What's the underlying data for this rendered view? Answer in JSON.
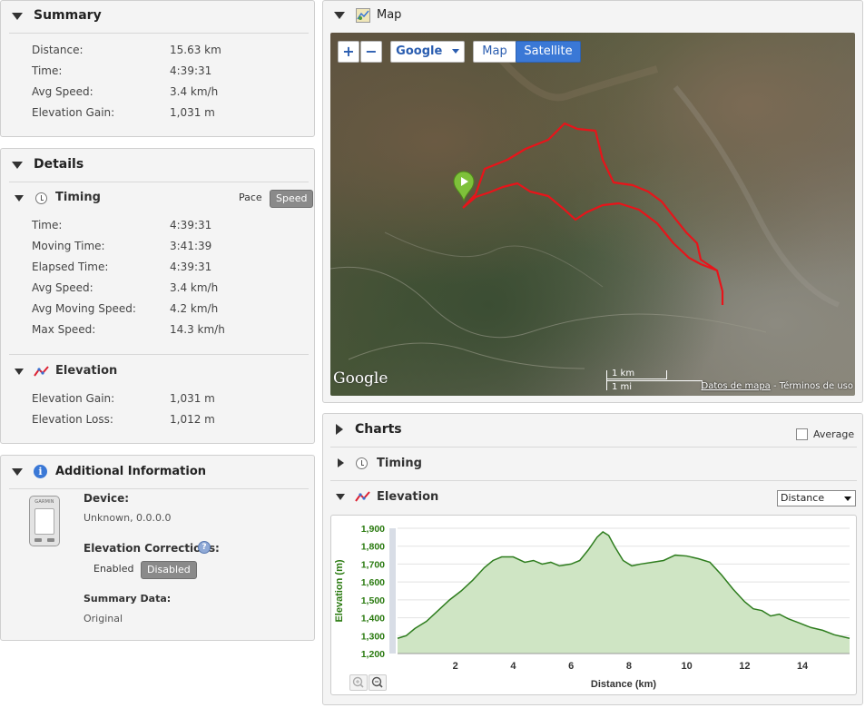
{
  "summary": {
    "title": "Summary",
    "rows": [
      {
        "label": "Distance:",
        "value": "15.63 km"
      },
      {
        "label": "Time:",
        "value": "4:39:31"
      },
      {
        "label": "Avg Speed:",
        "value": "3.4 km/h"
      },
      {
        "label": "Elevation Gain:",
        "value": "1,031 m"
      }
    ]
  },
  "details": {
    "title": "Details",
    "timing": {
      "title": "Timing",
      "pace_label": "Pace",
      "speed_label": "Speed",
      "rows": [
        {
          "label": "Time:",
          "value": "4:39:31"
        },
        {
          "label": "Moving Time:",
          "value": "3:41:39"
        },
        {
          "label": "Elapsed Time:",
          "value": "4:39:31"
        },
        {
          "label": "Avg Speed:",
          "value": "3.4 km/h"
        },
        {
          "label": "Avg Moving Speed:",
          "value": "4.2 km/h"
        },
        {
          "label": "Max Speed:",
          "value": "14.3 km/h"
        }
      ]
    },
    "elevation": {
      "title": "Elevation",
      "rows": [
        {
          "label": "Elevation Gain:",
          "value": "1,031 m"
        },
        {
          "label": "Elevation Loss:",
          "value": "1,012 m"
        }
      ]
    }
  },
  "additional": {
    "title": "Additional Information",
    "device_label": "Device:",
    "device_value": "Unknown, 0.0.0.0",
    "corrections_label": "Elevation Corrections",
    "corrections_colon": ":",
    "enabled_label": "Enabled",
    "disabled_label": "Disabled",
    "summary_data_label": "Summary Data:",
    "summary_data_value": "Original",
    "device_brand": "GARMIN"
  },
  "map": {
    "title": "Map",
    "zoom_in": "+",
    "zoom_out": "−",
    "provider": "Google",
    "map_btn": "Map",
    "satellite_btn": "Satellite",
    "logo": "Google",
    "scale_km": "1 km",
    "scale_mi": "1 mi",
    "datos_link": "Datos de mapa",
    "separator": " - ",
    "terms_link": "Términos de uso"
  },
  "charts": {
    "title": "Charts",
    "average_label": "Average",
    "timing_label": "Timing",
    "elevation_label": "Elevation",
    "xaxis_select": "Distance"
  },
  "colors": {
    "route": "#e8141a",
    "chart_fill": "#cfe5c4",
    "chart_line": "#2e7d1e",
    "axis_text": "#2a7a10",
    "accent_blue": "#3a78d6"
  },
  "chart_data": {
    "type": "area",
    "xlabel": "Distance (km)",
    "ylabel": "Elevation (m)",
    "xlim": [
      0,
      15.63
    ],
    "ylim": [
      1200,
      1900
    ],
    "xticks": [
      2,
      4,
      6,
      8,
      10,
      12,
      14
    ],
    "yticks": [
      1200,
      1300,
      1400,
      1500,
      1600,
      1700,
      1800,
      1900
    ],
    "ytick_labels": [
      "1,200",
      "1,300",
      "1,400",
      "1,500",
      "1,600",
      "1,700",
      "1,800",
      "1,900"
    ],
    "grid": true,
    "x": [
      0,
      0.3,
      0.6,
      1.0,
      1.4,
      1.8,
      2.2,
      2.6,
      3.0,
      3.3,
      3.6,
      4.0,
      4.4,
      4.7,
      5.0,
      5.3,
      5.6,
      6.0,
      6.3,
      6.6,
      6.9,
      7.1,
      7.3,
      7.5,
      7.8,
      8.1,
      8.4,
      8.8,
      9.2,
      9.6,
      10.0,
      10.4,
      10.8,
      11.2,
      11.6,
      12.0,
      12.3,
      12.6,
      12.9,
      13.2,
      13.5,
      13.9,
      14.3,
      14.7,
      15.1,
      15.63
    ],
    "y": [
      1285,
      1300,
      1340,
      1380,
      1440,
      1500,
      1550,
      1610,
      1680,
      1720,
      1740,
      1740,
      1710,
      1720,
      1700,
      1710,
      1690,
      1700,
      1720,
      1780,
      1850,
      1880,
      1860,
      1800,
      1720,
      1690,
      1700,
      1710,
      1720,
      1750,
      1745,
      1730,
      1710,
      1640,
      1560,
      1490,
      1450,
      1440,
      1410,
      1420,
      1395,
      1370,
      1345,
      1330,
      1305,
      1285
    ]
  }
}
